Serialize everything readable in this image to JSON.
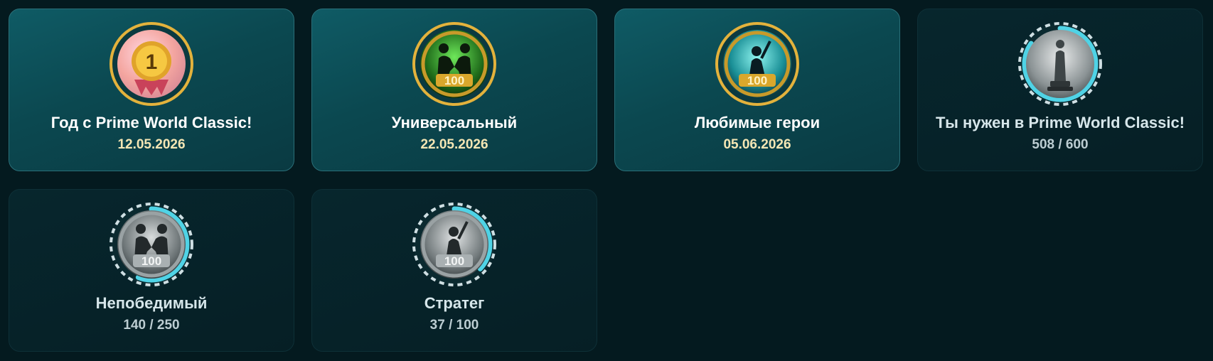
{
  "achievements": [
    {
      "title": "Год с Prime World Classic!",
      "status": "12.05.2026",
      "completed": true,
      "icon": "gold-medal-number-one-icon",
      "progress": 1.0
    },
    {
      "title": "Универсальный",
      "status": "22.05.2026",
      "completed": true,
      "icon": "handshake-laurel-100-icon",
      "progress": 1.0
    },
    {
      "title": "Любимые герои",
      "status": "05.06.2026",
      "completed": true,
      "icon": "hero-laurel-100-icon",
      "progress": 1.0
    },
    {
      "title": "Ты нужен в Prime World Classic!",
      "status": "508 / 600",
      "completed": false,
      "icon": "trophy-statue-icon",
      "progress": 0.8467
    },
    {
      "title": "Непобедимый",
      "status": "140 / 250",
      "completed": false,
      "icon": "handshake-laurel-100-icon",
      "progress": 0.56
    },
    {
      "title": "Стратег",
      "status": "37 / 100",
      "completed": false,
      "icon": "hero-laurel-100-icon",
      "progress": 0.37
    }
  ],
  "colors": {
    "background": "#041a1f",
    "completed_ring": "#e3b23c",
    "progress_ring": "#4fd3e6",
    "dashed_ring": "#cfdfe3"
  }
}
